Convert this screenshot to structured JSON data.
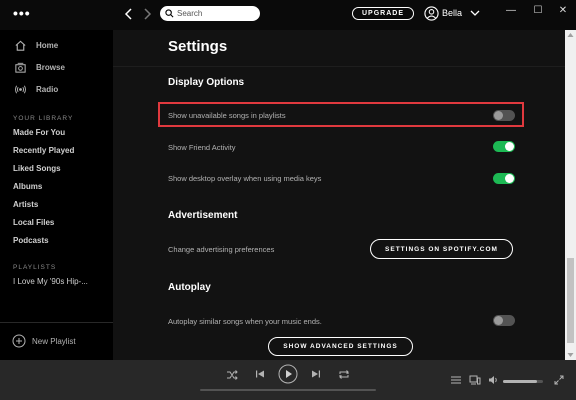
{
  "titlebar": {
    "menu_dots": "•••",
    "search_placeholder": "Search",
    "upgrade_label": "UPGRADE",
    "username": "Bella",
    "minimize": "—",
    "maximize": "☐",
    "close": "✕"
  },
  "sidebar": {
    "nav": [
      {
        "label": "Home",
        "icon": "home-icon"
      },
      {
        "label": "Browse",
        "icon": "browse-icon"
      },
      {
        "label": "Radio",
        "icon": "radio-icon"
      }
    ],
    "library_heading": "YOUR LIBRARY",
    "library": [
      "Made For You",
      "Recently Played",
      "Liked Songs",
      "Albums",
      "Artists",
      "Local Files",
      "Podcasts"
    ],
    "playlists_heading": "PLAYLISTS",
    "playlists": [
      "I Love My '90s Hip-..."
    ],
    "new_playlist": "New Playlist"
  },
  "main": {
    "title": "Settings",
    "display_options": {
      "heading": "Display Options",
      "settings": [
        {
          "label": "Show unavailable songs in playlists",
          "enabled": false,
          "highlighted": true
        },
        {
          "label": "Show Friend Activity",
          "enabled": true
        },
        {
          "label": "Show desktop overlay when using media keys",
          "enabled": true
        }
      ]
    },
    "advertisement": {
      "heading": "Advertisement",
      "label": "Change advertising preferences",
      "button": "SETTINGS ON SPOTIFY.COM"
    },
    "autoplay": {
      "heading": "Autoplay",
      "label": "Autoplay similar songs when your music ends.",
      "enabled": false
    },
    "advanced_button": "SHOW ADVANCED SETTINGS"
  },
  "player": {
    "volume_fraction": 0.85
  },
  "colors": {
    "accent": "#1db954",
    "highlight_border": "#e0393e",
    "background": "#121212",
    "sidebar": "#000000",
    "player": "#282828"
  }
}
